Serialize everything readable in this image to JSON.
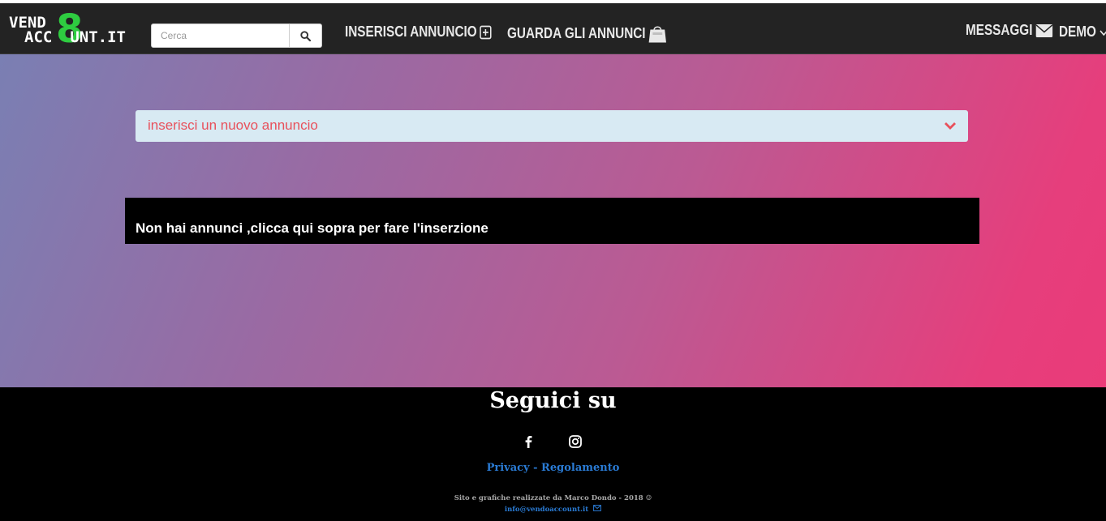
{
  "brand": {
    "line1": "VEND",
    "eight": "8",
    "line2": "ACC",
    "line2_end": "UNT.IT"
  },
  "search": {
    "placeholder": "Cerca"
  },
  "nav": {
    "insert_ad": "INSERISCI ANNUNCIO",
    "view_ads": "GUARDA GLI ANNUNCI",
    "messages": "MESSAGGI",
    "user": "DEMO"
  },
  "main": {
    "accordion_title": "inserisci un nuovo annuncio",
    "empty_message": "Non hai annunci ,clicca qui sopra per fare l'inserzione"
  },
  "footer": {
    "follow_title": "Seguici su",
    "privacy": "Privacy",
    "separator": " - ",
    "rules": "Regolamento",
    "credit": "Sito e grafiche realizzate da Marco Dondo - 2018 ☺",
    "email": "info@vendoaccount.it"
  },
  "colors": {
    "navbar": "#232323",
    "logo_accent": "#2ecc40",
    "accordion_bg": "#d8eaf3",
    "accordion_text": "#e8505b",
    "link": "#2a7bd4"
  }
}
